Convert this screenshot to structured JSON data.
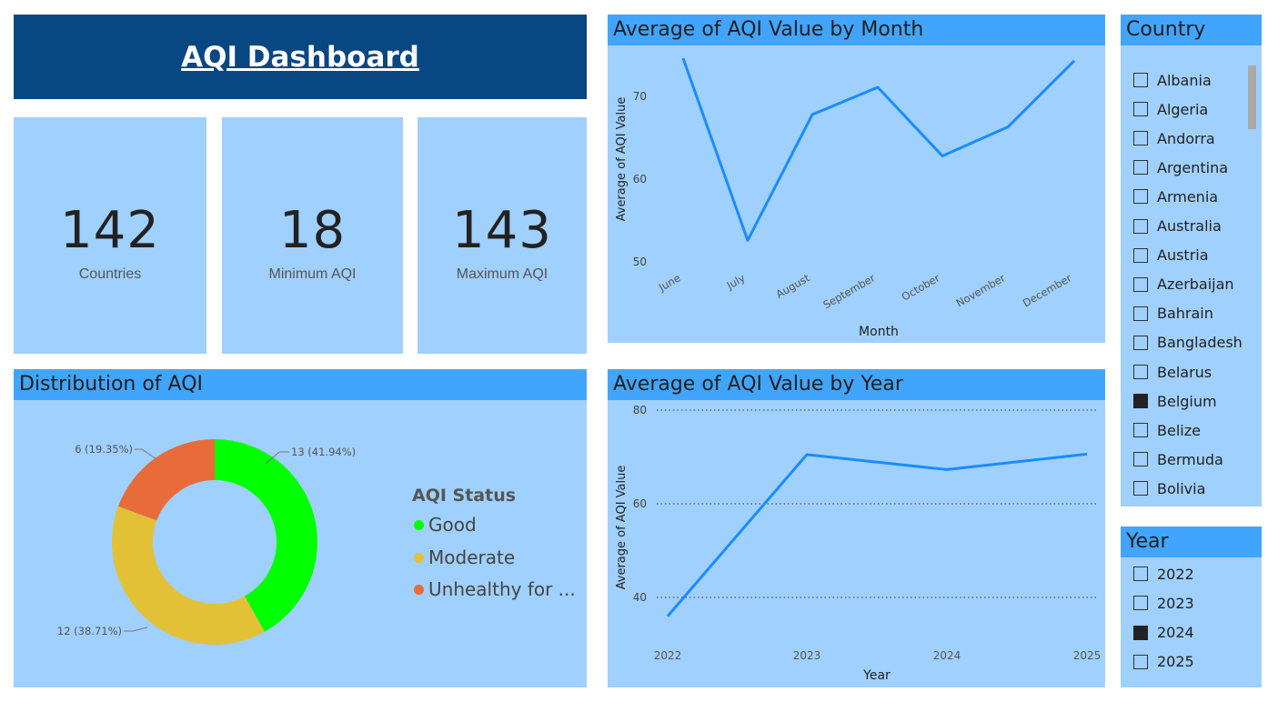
{
  "header": {
    "title": "AQI Dashboard"
  },
  "cards": [
    {
      "value": "142",
      "label": "Countries"
    },
    {
      "value": "18",
      "label": "Minimum AQI"
    },
    {
      "value": "143",
      "label": "Maximum AQI"
    }
  ],
  "month_chart": {
    "title": "Average of AQI Value by Month",
    "xlabel": "Month",
    "ylabel": "Average of AQI Value",
    "yticks": [
      "70",
      "60",
      "50"
    ]
  },
  "year_chart": {
    "title": "Average of AQI Value by Year",
    "xlabel": "Year",
    "ylabel": "Average of AQI Value",
    "yticks": [
      "80",
      "60",
      "40"
    ]
  },
  "distribution": {
    "title": "Distribution of AQI",
    "legend_title": "AQI Status",
    "legend": [
      "Good",
      "Moderate",
      "Unhealthy for ..."
    ],
    "labels": [
      "13 (41.94%)",
      "12 (38.71%)",
      "6 (19.35%)"
    ]
  },
  "country_slicer": {
    "title": "Country",
    "items": [
      {
        "label": "Albania",
        "checked": false
      },
      {
        "label": "Algeria",
        "checked": false
      },
      {
        "label": "Andorra",
        "checked": false
      },
      {
        "label": "Argentina",
        "checked": false
      },
      {
        "label": "Armenia",
        "checked": false
      },
      {
        "label": "Australia",
        "checked": false
      },
      {
        "label": "Austria",
        "checked": false
      },
      {
        "label": "Azerbaijan",
        "checked": false
      },
      {
        "label": "Bahrain",
        "checked": false
      },
      {
        "label": "Bangladesh",
        "checked": false
      },
      {
        "label": "Belarus",
        "checked": false
      },
      {
        "label": "Belgium",
        "checked": true
      },
      {
        "label": "Belize",
        "checked": false
      },
      {
        "label": "Bermuda",
        "checked": false
      },
      {
        "label": "Bolivia",
        "checked": false
      }
    ]
  },
  "year_slicer": {
    "title": "Year",
    "items": [
      {
        "label": "2022",
        "checked": false
      },
      {
        "label": "2023",
        "checked": false
      },
      {
        "label": "2024",
        "checked": true
      },
      {
        "label": "2025",
        "checked": false
      }
    ]
  },
  "colors": {
    "header_bg": "#084782",
    "panel_bg": "#a0d0fd",
    "titlebar_bg": "#41a5fe",
    "line": "#1a8cff",
    "good": "#00ff00",
    "moderate": "#e2c136",
    "unhealthy": "#e86c3a"
  },
  "chart_data": [
    {
      "type": "line",
      "title": "Average of AQI Value by Month",
      "xlabel": "Month",
      "ylabel": "Average of AQI Value",
      "categories": [
        "June",
        "July",
        "August",
        "September",
        "October",
        "November",
        "December"
      ],
      "values": [
        74.6,
        52.6,
        67.8,
        71.1,
        62.8,
        66.3,
        74.3
      ],
      "ylim": [
        50,
        76
      ]
    },
    {
      "type": "line",
      "title": "Average of AQI Value by Year",
      "xlabel": "Year",
      "ylabel": "Average of AQI Value",
      "categories": [
        "2022",
        "2023",
        "2024",
        "2025"
      ],
      "values": [
        36,
        70.5,
        67.3,
        70.6
      ],
      "ylim": [
        30,
        80
      ],
      "grid": true
    },
    {
      "type": "pie",
      "title": "Distribution of AQI",
      "legend_title": "AQI Status",
      "categories": [
        "Good",
        "Moderate",
        "Unhealthy for ..."
      ],
      "values": [
        13,
        12,
        6
      ],
      "percentages": [
        41.94,
        38.71,
        19.35
      ]
    }
  ]
}
